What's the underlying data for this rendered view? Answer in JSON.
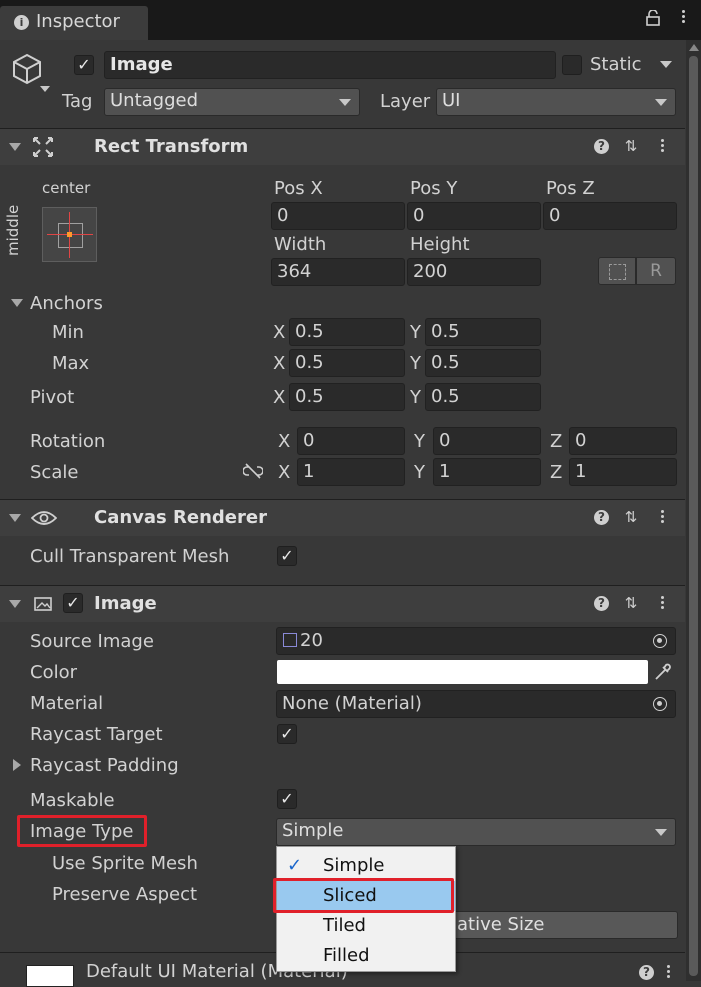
{
  "tab": {
    "title": "Inspector"
  },
  "object": {
    "name": "Image",
    "static_label": "Static",
    "tag_label": "Tag",
    "tag_value": "Untagged",
    "layer_label": "Layer",
    "layer_value": "UI"
  },
  "rect_transform": {
    "title": "Rect Transform",
    "anchor_h": "center",
    "anchor_v": "middle",
    "pos_x_label": "Pos X",
    "pos_y_label": "Pos Y",
    "pos_z_label": "Pos Z",
    "pos_x": "0",
    "pos_y": "0",
    "pos_z": "0",
    "width_label": "Width",
    "height_label": "Height",
    "width": "364",
    "height": "200",
    "r_button": "R",
    "anchors_label": "Anchors",
    "min_label": "Min",
    "max_label": "Max",
    "pivot_label": "Pivot",
    "min_x": "0.5",
    "min_y": "0.5",
    "max_x": "0.5",
    "max_y": "0.5",
    "pivot_x": "0.5",
    "pivot_y": "0.5",
    "rotation_label": "Rotation",
    "scale_label": "Scale",
    "rot_x": "0",
    "rot_y": "0",
    "rot_z": "0",
    "scale_x": "1",
    "scale_y": "1",
    "scale_z": "1",
    "x": "X",
    "y": "Y",
    "z": "Z"
  },
  "canvas_renderer": {
    "title": "Canvas Renderer",
    "cull_label": "Cull Transparent Mesh"
  },
  "image": {
    "title": "Image",
    "source_image_label": "Source Image",
    "source_image_value": "20",
    "color_label": "Color",
    "material_label": "Material",
    "material_value": "None (Material)",
    "raycast_target_label": "Raycast Target",
    "raycast_padding_label": "Raycast Padding",
    "maskable_label": "Maskable",
    "image_type_label": "Image Type",
    "image_type_value": "Simple",
    "use_sprite_mesh_label": "Use Sprite Mesh",
    "preserve_aspect_label": "Preserve Aspect",
    "native_size_button": "ative Size"
  },
  "dropdown": {
    "options": [
      "Simple",
      "Sliced",
      "Tiled",
      "Filled"
    ],
    "checked": "Simple",
    "highlighted": "Sliced"
  },
  "footer": {
    "material_label": "Default UI Material (Material)"
  },
  "colors": {
    "highlight": "#99c9ef",
    "annotation": "#e0202a",
    "panel": "#383838"
  }
}
